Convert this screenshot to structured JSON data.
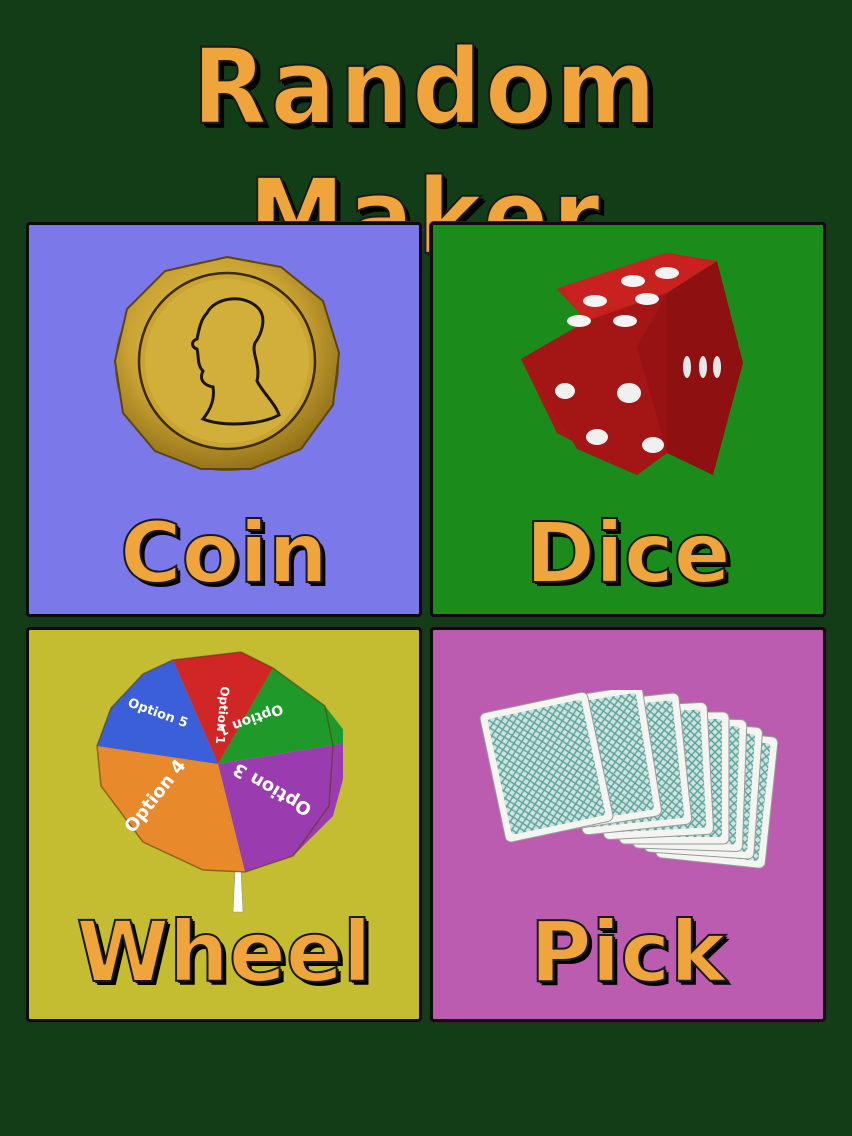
{
  "app": {
    "title": "Random Maker"
  },
  "modes": [
    {
      "id": "coin",
      "label": "Coin",
      "color": "#7b78ea",
      "icon": "coin-icon"
    },
    {
      "id": "dice",
      "label": "Dice",
      "color": "#1b8b1b",
      "icon": "dice-icon"
    },
    {
      "id": "wheel",
      "label": "Wheel",
      "color": "#c4bd32",
      "icon": "wheel-icon"
    },
    {
      "id": "pick",
      "label": "Pick",
      "color": "#bc5cb0",
      "icon": "cards-icon"
    }
  ],
  "wheel": {
    "segments": [
      {
        "label": "Option 1",
        "color": "#d02626"
      },
      {
        "label": "Option 1",
        "color": "#1f9a2a"
      },
      {
        "label": "Option 3",
        "color": "#9a3cb0"
      },
      {
        "label": "Option 4",
        "color": "#e88a2c"
      },
      {
        "label": "Option 5",
        "color": "#3a5fd8"
      }
    ]
  },
  "theme": {
    "background": "#133d17",
    "accent": "#f0a43c"
  }
}
